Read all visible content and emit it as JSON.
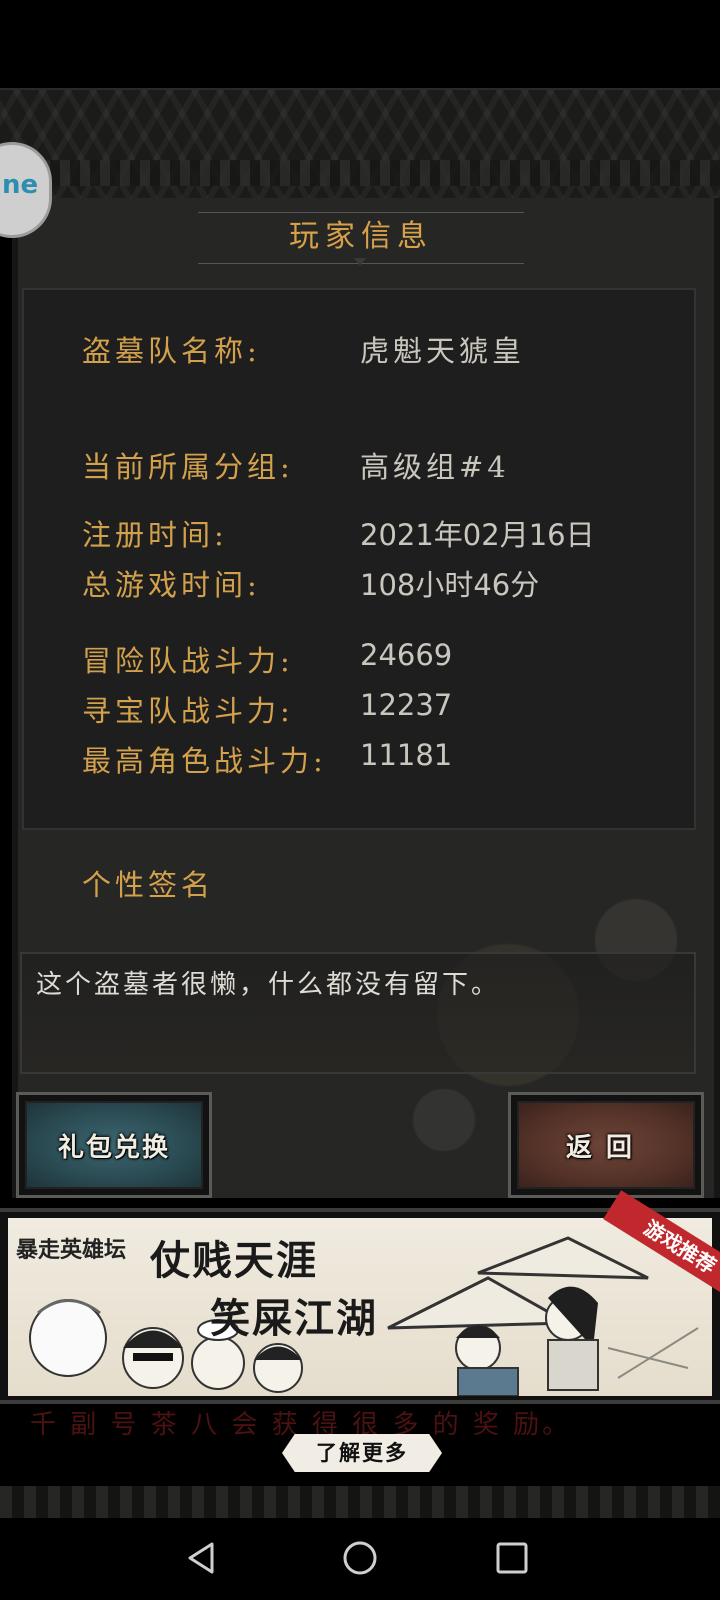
{
  "header": {
    "title": "玩家信息"
  },
  "float_badge": {
    "label": "ne"
  },
  "info": {
    "rows": [
      {
        "label": "盗墓队名称:",
        "value": "虎魁天猇皇"
      },
      {
        "label": "当前所属分组:",
        "value": "高级组#4"
      },
      {
        "label": "注册时间:",
        "value": "2021年02月16日"
      },
      {
        "label": "总游戏时间:",
        "value": "108小时46分"
      },
      {
        "label": "冒险队战斗力:",
        "value": "24669"
      },
      {
        "label": "寻宝队战斗力:",
        "value": "12237"
      },
      {
        "label": "最高角色战斗力:",
        "value": "11181"
      }
    ]
  },
  "signature": {
    "title": "个性签名",
    "text": "这个盗墓者很懒，什么都没有留下。"
  },
  "buttons": {
    "gift": "礼包兑换",
    "back": "返回"
  },
  "ad": {
    "brand": "暴走英雄坛",
    "line1": "仗贱天涯",
    "line2": "笑屎江湖",
    "ribbon": "游戏推荐",
    "hidden_tip": "千 副 号 茶 八 会 获 得 很 多 的 奖 励。",
    "learn_more": "了解更多"
  },
  "nav": {
    "back_icon": "triangle-back-icon",
    "home_icon": "circle-home-icon",
    "recents_icon": "square-recents-icon"
  },
  "colors": {
    "label_gold": "#d3a14c",
    "value_text": "#c9c6bd",
    "panel_bg": "#262625",
    "gift_button": "#2a4a52",
    "back_button": "#543228",
    "ribbon_red": "#c0282d"
  }
}
